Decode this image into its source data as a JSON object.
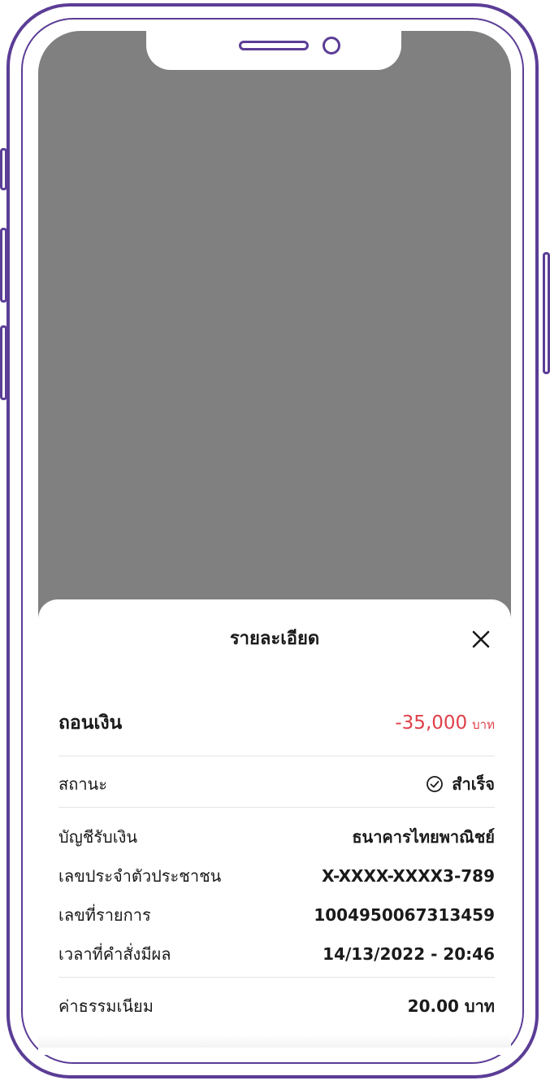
{
  "sheet": {
    "title": "รายละเอียด",
    "close_icon": "close-icon"
  },
  "transaction": {
    "type_label": "ถอนเงิน",
    "amount": "-35,000",
    "amount_unit": "บาท",
    "amount_color": "#e0404a"
  },
  "details": [
    {
      "label": "สถานะ",
      "value": "สำเร็จ",
      "icon": "check-circle-icon"
    },
    {
      "label": "บัญชีรับเงิน",
      "value": "ธนาคารไทยพาณิชย์"
    },
    {
      "label": "เลขประจำตัวประชาชน",
      "value": "X-XXXX-XXXX3-789"
    },
    {
      "label": "เลขที่รายการ",
      "value": "1004950067313459"
    },
    {
      "label": "เวลาที่คำสั่งมีผล",
      "value": "14/13/2022 - 20:46"
    },
    {
      "label": "ค่าธรรมเนียม",
      "value": "20.00 บาท"
    }
  ],
  "colors": {
    "phone_frame": "#5b3d96",
    "screen_overlay": "#808080"
  }
}
